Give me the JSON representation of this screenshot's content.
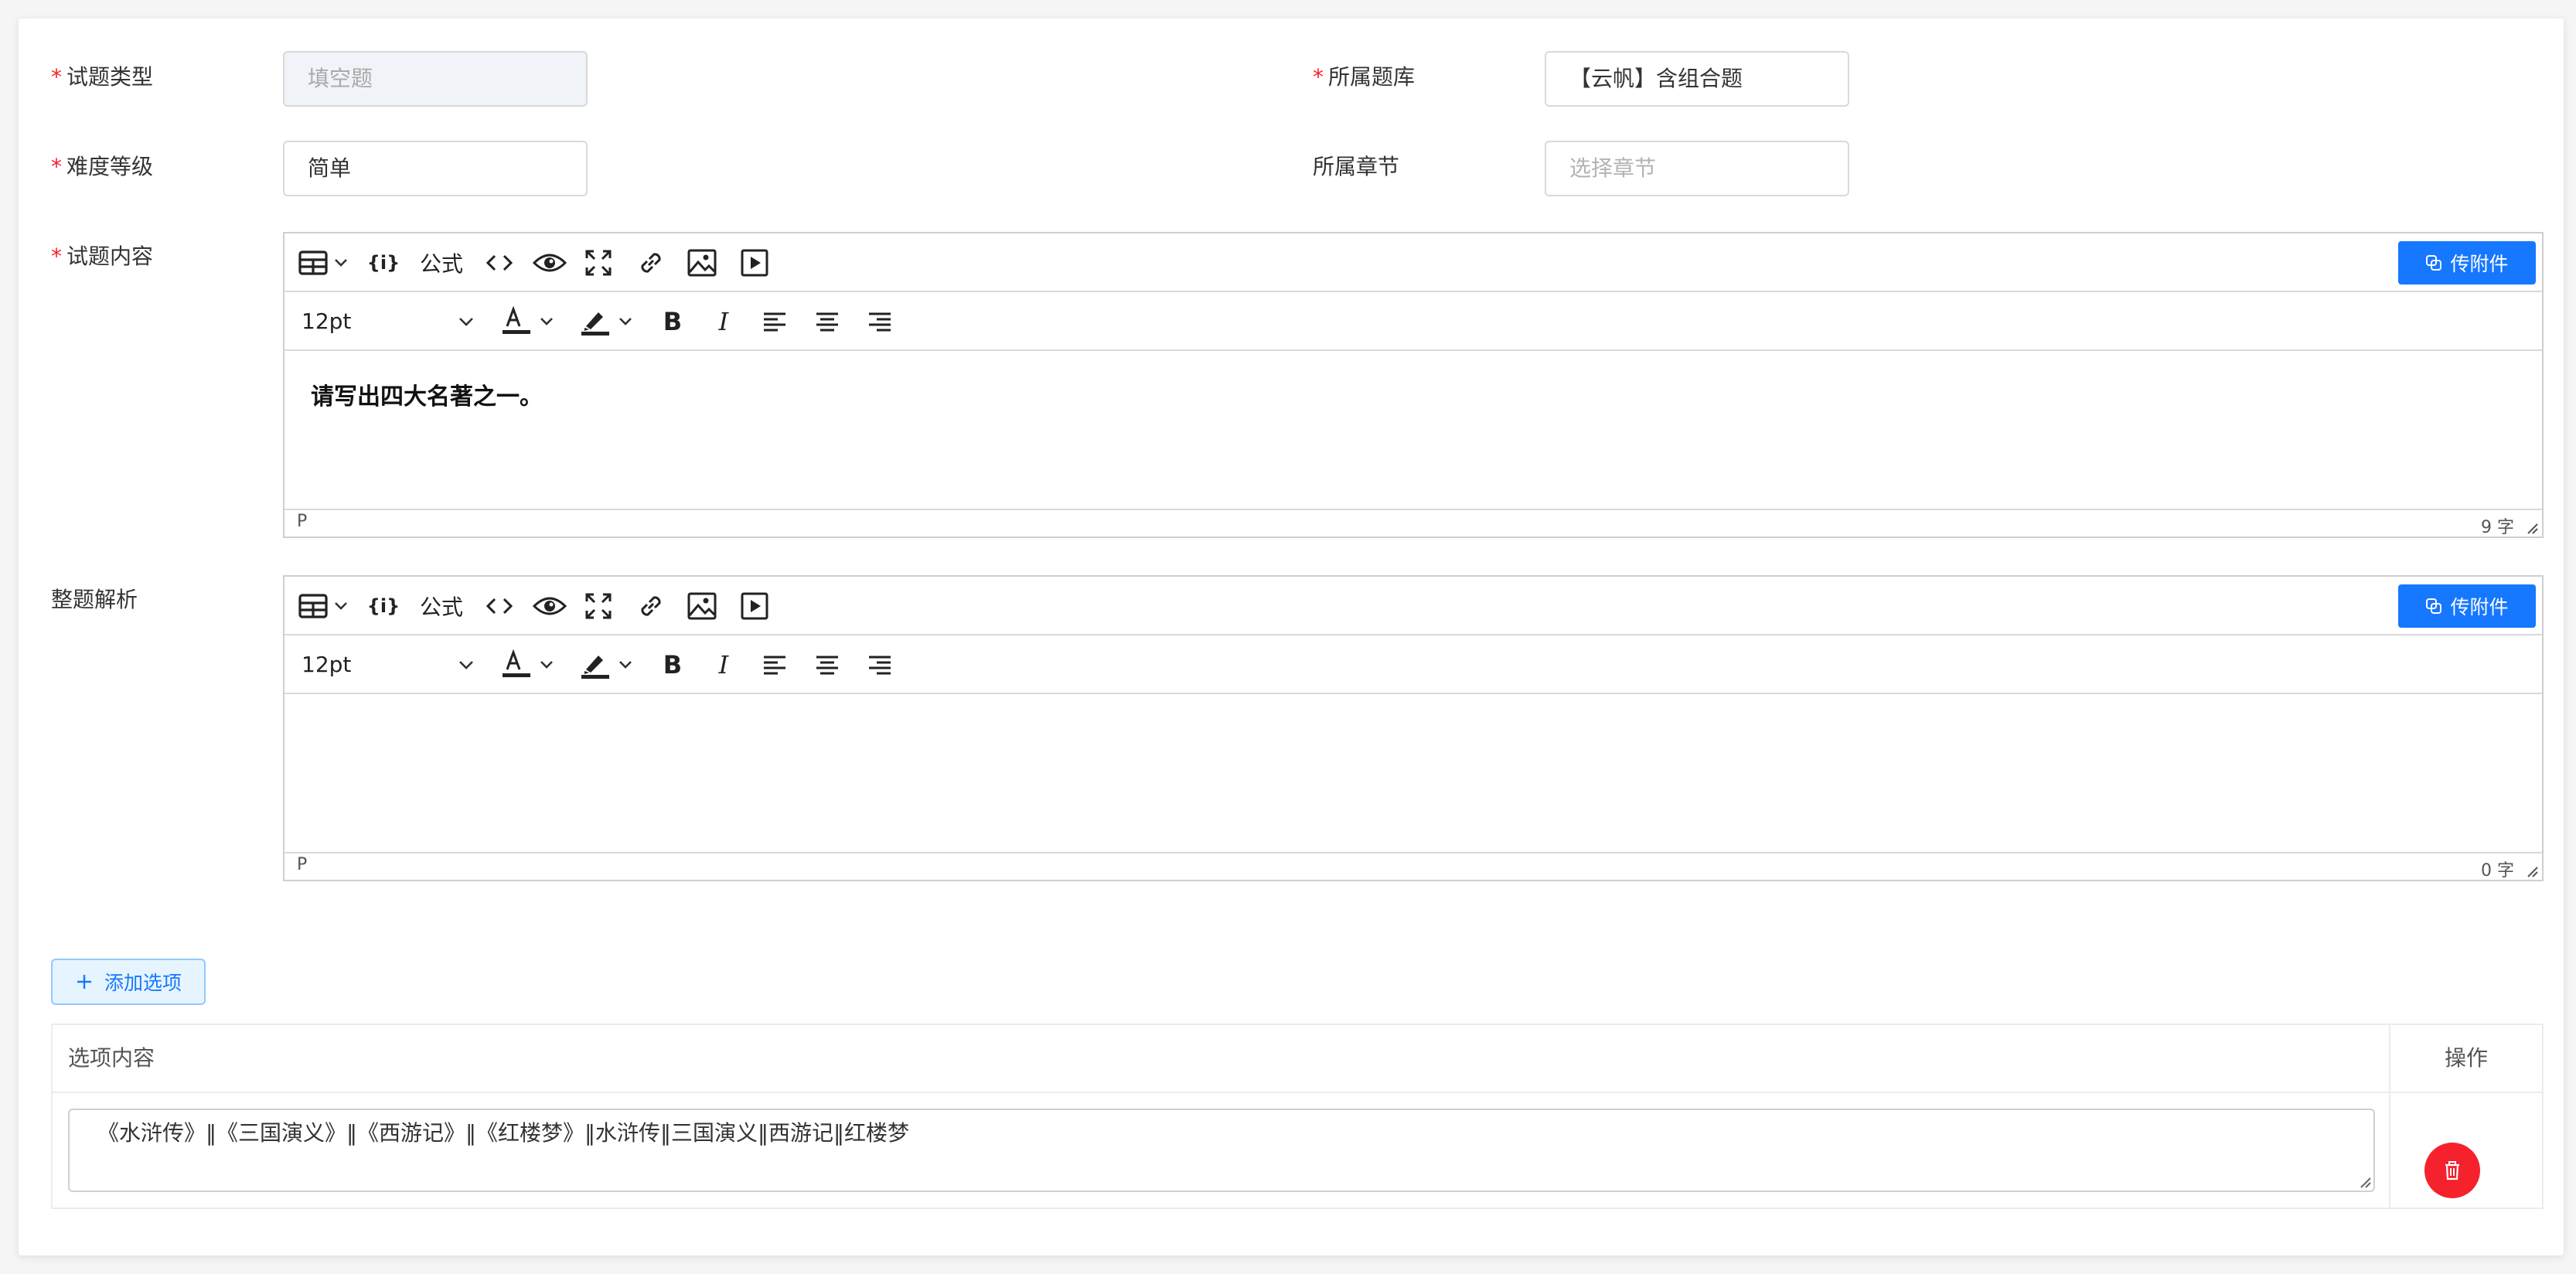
{
  "form": {
    "question_type": {
      "label": "试题类型",
      "value": "填空题"
    },
    "question_bank": {
      "label": "所属题库",
      "value": "【云帆】含组合题"
    },
    "difficulty": {
      "label": "难度等级",
      "value": "简单"
    },
    "chapter": {
      "label": "所属章节",
      "placeholder": "选择章节"
    },
    "content_label": "试题内容",
    "analysis_label": "整题解析"
  },
  "editor_toolbar": {
    "formula_label": "公式",
    "font_size": "12pt",
    "upload_label": "传附件"
  },
  "content_editor": {
    "text": "请写出四大名著之一。",
    "path": "P",
    "word_count": "9 字"
  },
  "analysis_editor": {
    "text": "",
    "path": "P",
    "word_count": "0 字"
  },
  "options": {
    "add_label": "添加选项",
    "col_content": "选项内容",
    "col_action": "操作",
    "rows": [
      {
        "content": "《水浒传》‖《三国演义》‖《西游记》‖《红楼梦》‖水浒传‖三国演义‖西游记‖红楼梦"
      }
    ]
  },
  "colors": {
    "primary": "#1677ff",
    "danger": "#f5222d",
    "required": "#f5222d"
  }
}
